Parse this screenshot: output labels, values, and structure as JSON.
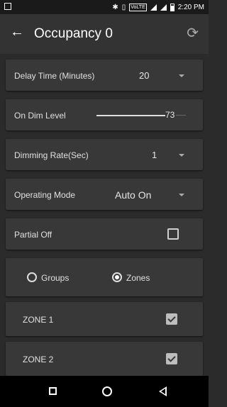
{
  "status_bar": {
    "time": "2:20 PM",
    "network": "VoLTE"
  },
  "header": {
    "title": "Occupancy 0"
  },
  "settings": {
    "delay_time": {
      "label": "Delay Time (Minutes)",
      "value": "20"
    },
    "on_dim_level": {
      "label": "On Dim Level",
      "value": "73",
      "level_fraction": 0.73
    },
    "dimming_rate": {
      "label": "Dimming Rate(Sec)",
      "value": "1"
    },
    "operating_mode": {
      "label": "Operating Mode",
      "value": "Auto On"
    },
    "partial_off": {
      "label": "Partial Off",
      "checked": false
    }
  },
  "selector": {
    "groups_label": "Groups",
    "zones_label": "Zones",
    "selected": "Zones"
  },
  "zones": [
    {
      "label": "ZONE 1",
      "checked": true
    },
    {
      "label": "ZONE 2",
      "checked": true
    }
  ],
  "colors": {
    "background": "#2b2b2b",
    "card": "#383838",
    "app_bar": "#333333"
  }
}
